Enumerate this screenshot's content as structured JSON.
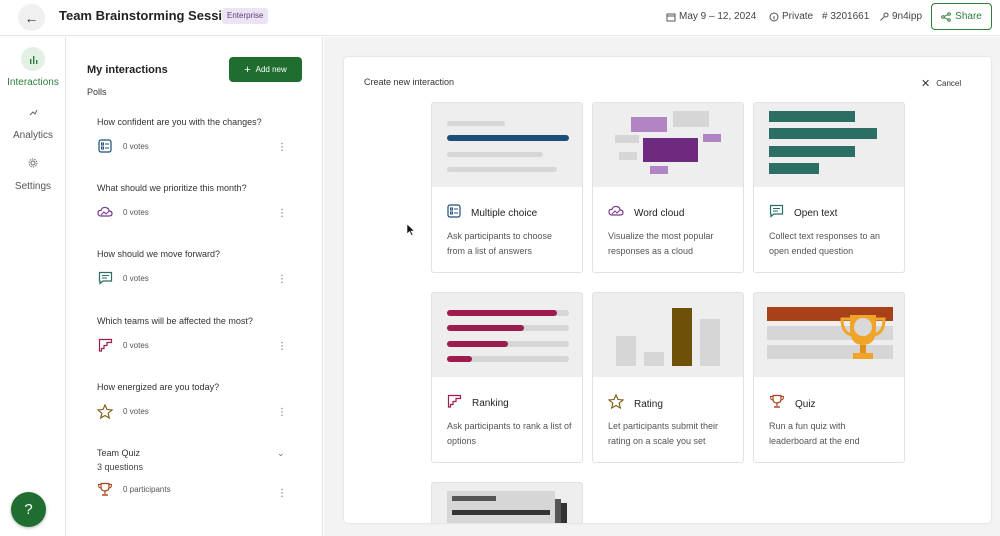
{
  "header": {
    "back_icon": "arrow-left-icon",
    "title": "Team Brainstorming Session",
    "badge": "Enterprise",
    "date": "May 9 – 12, 2024",
    "privacy": "Private",
    "event_code": "# 3201661",
    "passcode": "9n4ipp",
    "share_label": "Share"
  },
  "leftnav": {
    "items": [
      {
        "label": "Interactions",
        "icon": "bar-chart-icon",
        "active": true
      },
      {
        "label": "Analytics",
        "icon": "trend-up-icon",
        "active": false
      },
      {
        "label": "Settings",
        "icon": "gear-icon",
        "active": false
      }
    ],
    "help_icon": "question-icon"
  },
  "midpanel": {
    "title": "My interactions",
    "add_label": "Add new",
    "section": "Polls",
    "polls": [
      {
        "question": "How confident are you with the changes?",
        "votes": "0 votes",
        "icon": "multiple-choice-icon"
      },
      {
        "question": "What should we prioritize this month?",
        "votes": "0 votes",
        "icon": "word-cloud-icon"
      },
      {
        "question": "How should we move forward?",
        "votes": "0 votes",
        "icon": "open-text-icon"
      },
      {
        "question": "Which teams will be affected the most?",
        "votes": "0 votes",
        "icon": "ranking-icon"
      },
      {
        "question": "How energized are you today?",
        "votes": "0 votes",
        "icon": "star-icon"
      }
    ],
    "quiz": {
      "title": "Team Quiz",
      "sub": "3 questions",
      "participants": "0 participants",
      "icon": "trophy-icon"
    }
  },
  "create": {
    "title": "Create new interaction",
    "cancel": "Cancel",
    "types": [
      {
        "name": "Multiple choice",
        "desc": "Ask participants to choose from a list of answers",
        "icon": "multiple-choice-icon"
      },
      {
        "name": "Word cloud",
        "desc": "Visualize the most popular responses as a cloud",
        "icon": "word-cloud-icon"
      },
      {
        "name": "Open text",
        "desc": "Collect text responses to an open ended question",
        "icon": "open-text-icon"
      },
      {
        "name": "Ranking",
        "desc": "Ask participants to rank a list of options",
        "icon": "ranking-icon"
      },
      {
        "name": "Rating",
        "desc": "Let participants submit their rating on a scale you set",
        "icon": "star-icon"
      },
      {
        "name": "Quiz",
        "desc": "Run a fun quiz with leaderboard at the end",
        "icon": "trophy-icon"
      }
    ]
  },
  "colors": {
    "brand_green": "#1f6e2f",
    "multiple_choice": "#1d4e7a",
    "word_cloud": "#7a3a8c",
    "open_text": "#2a6e64",
    "ranking": "#9c1c4e",
    "rating": "#7a5a10",
    "quiz": "#a8401a"
  }
}
